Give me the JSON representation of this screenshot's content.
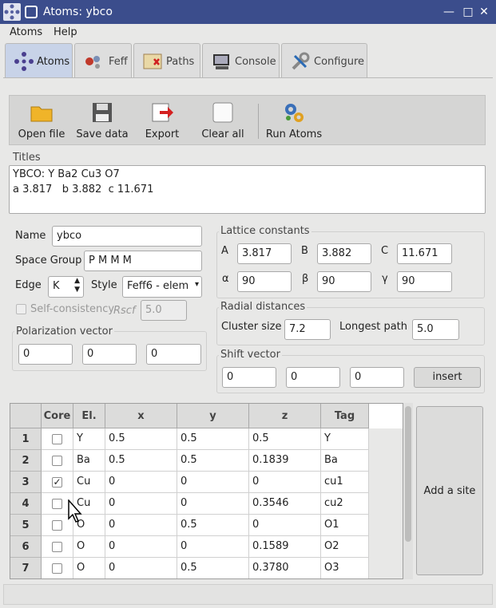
{
  "window": {
    "title": "Atoms: ybco"
  },
  "menu": {
    "items": [
      "Atoms",
      "Help"
    ]
  },
  "tabs": [
    "Atoms",
    "Feff",
    "Paths",
    "Console",
    "Configure"
  ],
  "toolbar": {
    "open": "Open file",
    "save": "Save data",
    "export": "Export",
    "clear": "Clear all",
    "run": "Run Atoms"
  },
  "titles": {
    "label": "Titles",
    "line1": "YBCO: Y Ba2 Cu3 O7",
    "line2": "a 3.817   b 3.882  c 11.671"
  },
  "form": {
    "name_label": "Name",
    "name_value": "ybco",
    "sg_label": "Space Group",
    "sg_value": "P M M M",
    "edge_label": "Edge",
    "edge_value": "K",
    "style_label": "Style",
    "style_value": "Feff6 - elem",
    "selfcons_label": "Self-consistency",
    "rscf_label": "Rscf",
    "rscf_value": "5.0",
    "pol_label": "Polarization vector",
    "pol": [
      "0",
      "0",
      "0"
    ]
  },
  "lattice": {
    "label": "Lattice constants",
    "a_label": "A",
    "a": "3.817",
    "b_label": "B",
    "b": "3.882",
    "c_label": "C",
    "c": "11.671",
    "alpha_label": "α",
    "alpha": "90",
    "beta_label": "β",
    "beta": "90",
    "gamma_label": "γ",
    "gamma": "90"
  },
  "radial": {
    "label": "Radial distances",
    "cluster_label": "Cluster size",
    "cluster": "7.2",
    "longest_label": "Longest path",
    "longest": "5.0"
  },
  "shift": {
    "label": "Shift vector",
    "values": [
      "0",
      "0",
      "0"
    ],
    "insert": "insert"
  },
  "table": {
    "headers": [
      "Core",
      "El.",
      "x",
      "y",
      "z",
      "Tag"
    ],
    "rows": [
      {
        "n": "1",
        "core": false,
        "el": "Y",
        "x": "0.5",
        "y": "0.5",
        "z": "0.5",
        "tag": "Y"
      },
      {
        "n": "2",
        "core": false,
        "el": "Ba",
        "x": "0.5",
        "y": "0.5",
        "z": "0.1839",
        "tag": "Ba"
      },
      {
        "n": "3",
        "core": true,
        "el": "Cu",
        "x": "0",
        "y": "0",
        "z": "0",
        "tag": "cu1"
      },
      {
        "n": "4",
        "core": false,
        "el": "Cu",
        "x": "0",
        "y": "0",
        "z": "0.3546",
        "tag": "cu2"
      },
      {
        "n": "5",
        "core": false,
        "el": "O",
        "x": "0",
        "y": "0.5",
        "z": "0",
        "tag": "O1"
      },
      {
        "n": "6",
        "core": false,
        "el": "O",
        "x": "0",
        "y": "0",
        "z": "0.1589",
        "tag": "O2"
      },
      {
        "n": "7",
        "core": false,
        "el": "O",
        "x": "0",
        "y": "0.5",
        "z": "0.3780",
        "tag": "O3"
      }
    ]
  },
  "add_site": "Add a site"
}
